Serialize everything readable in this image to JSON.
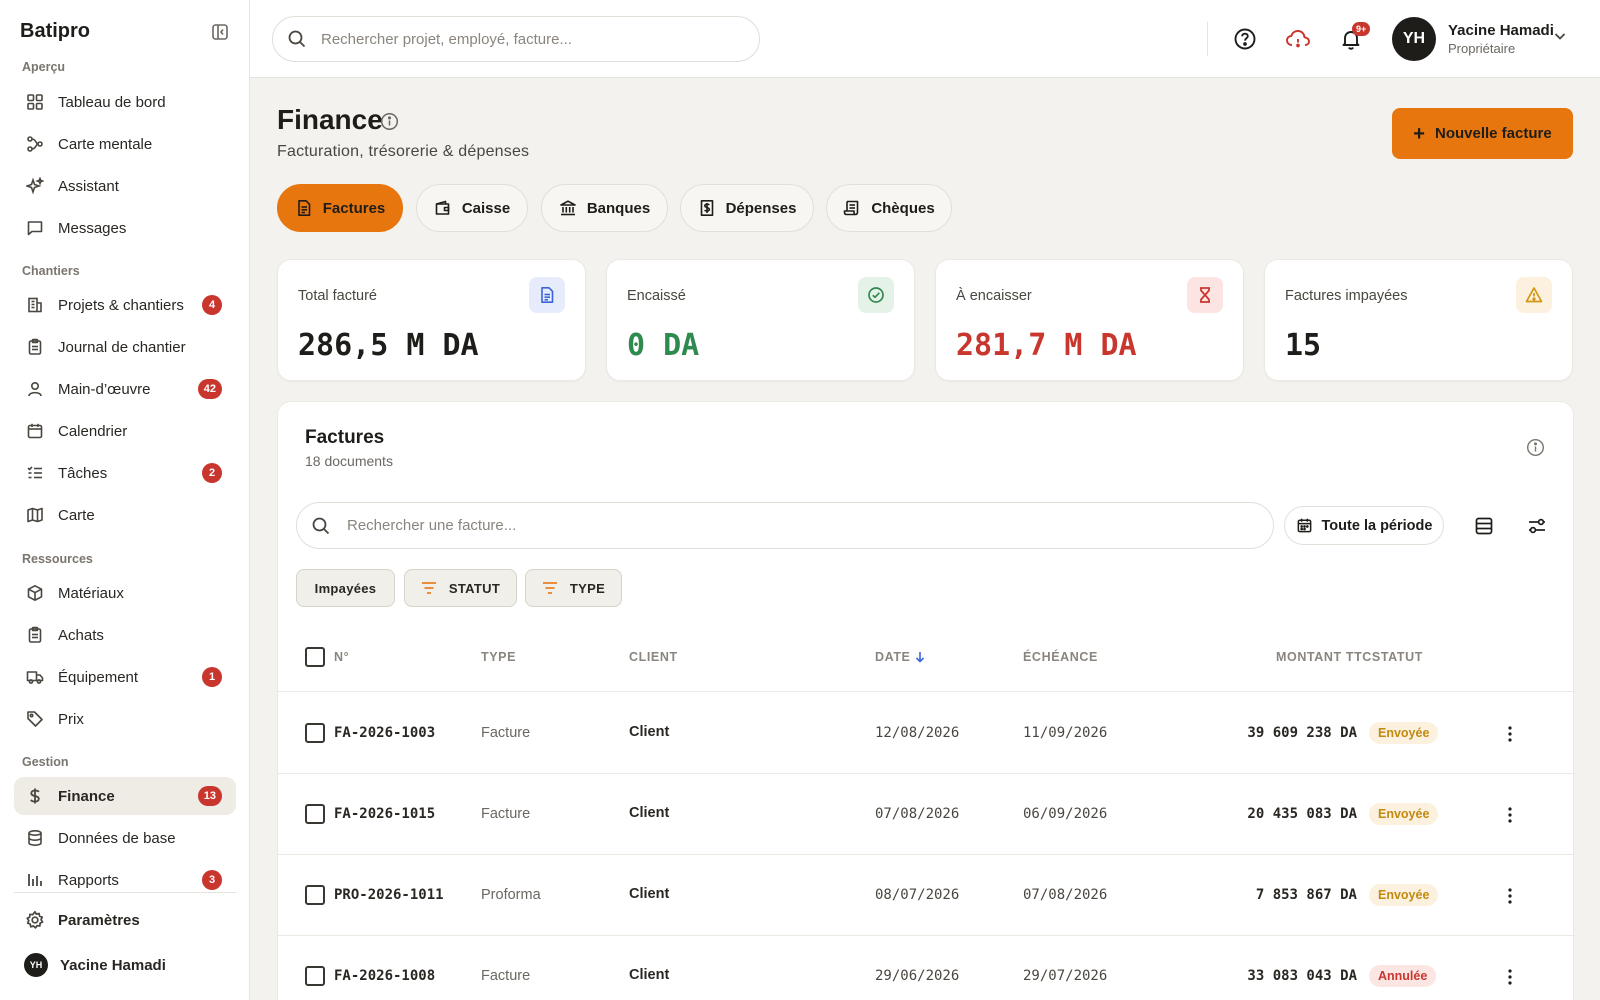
{
  "app": {
    "brand": "Batipro"
  },
  "sidebar": {
    "sections": {
      "apercu": "Aperçu",
      "chantiers": "Chantiers",
      "ressources": "Ressources",
      "gestion": "Gestion"
    },
    "items": [
      {
        "label": "Tableau de bord",
        "icon": "dashboard-icon"
      },
      {
        "label": "Carte mentale",
        "icon": "mindmap-icon"
      },
      {
        "label": "Assistant",
        "icon": "sparkle-icon"
      },
      {
        "label": "Messages",
        "icon": "message-icon"
      },
      {
        "label": "Projets & chantiers",
        "icon": "building-icon",
        "badge": "4"
      },
      {
        "label": "Journal de chantier",
        "icon": "clipboard-icon"
      },
      {
        "label": "Main-d’œuvre",
        "icon": "user-icon",
        "badge": "42"
      },
      {
        "label": "Calendrier",
        "icon": "calendar-icon"
      },
      {
        "label": "Tâches",
        "icon": "tasks-icon",
        "badge": "2"
      },
      {
        "label": "Carte",
        "icon": "map-icon"
      },
      {
        "label": "Matériaux",
        "icon": "box-icon"
      },
      {
        "label": "Achats",
        "icon": "clipboard-icon"
      },
      {
        "label": "Équipement",
        "icon": "truck-icon",
        "badge": "1"
      },
      {
        "label": "Prix",
        "icon": "tag-icon"
      },
      {
        "label": "Finance",
        "icon": "dollar-icon",
        "badge": "13"
      },
      {
        "label": "Données de base",
        "icon": "database-icon"
      },
      {
        "label": "Rapports",
        "icon": "bar-chart-icon",
        "badge": "3"
      }
    ],
    "settings": "Paramètres",
    "user": {
      "initials": "YH",
      "name": "Yacine Hamadi"
    }
  },
  "topbar": {
    "search_placeholder": "Rechercher projet, employé, facture...",
    "notif_badge": "9+",
    "user": {
      "initials": "YH",
      "name": "Yacine Hamadi",
      "role": "Propriétaire"
    }
  },
  "header": {
    "title": "Finance",
    "subtitle": "Facturation, trésorerie & dépenses",
    "new_invoice": "Nouvelle facture"
  },
  "tabs": [
    {
      "label": "Factures",
      "active": true
    },
    {
      "label": "Caisse"
    },
    {
      "label": "Banques"
    },
    {
      "label": "Dépenses"
    },
    {
      "label": "Chèques"
    }
  ],
  "stats": [
    {
      "label": "Total facturé",
      "value": "286,5 M DA",
      "color": "#1f1d1a",
      "icon": "document-icon"
    },
    {
      "label": "Encaissé",
      "value": "0 DA",
      "color": "#2f8a4f",
      "icon": "check-circle-icon"
    },
    {
      "label": "À encaisser",
      "value": "281,7 M DA",
      "color": "#c8362e",
      "icon": "hourglass-icon"
    },
    {
      "label": "Factures impayées",
      "value": "15",
      "color": "#1f1d1a",
      "icon": "warning-icon"
    }
  ],
  "invoices": {
    "title": "Factures",
    "count": "18 documents",
    "search_placeholder": "Rechercher une facture...",
    "period": "Toute la période",
    "chips": {
      "unpaid": "Impayées",
      "status": "STATUT",
      "type": "TYPE"
    },
    "columns": {
      "number": "N°",
      "type": "TYPE",
      "client": "CLIENT",
      "date": "DATE",
      "due": "ÉCHÉANCE",
      "amount_status": "MONTANT TTCSTATUT"
    },
    "rows": [
      {
        "number": "FA-2026-1003",
        "type": "Facture",
        "client": "Client",
        "date": "12/08/2026",
        "due": "11/09/2026",
        "amount": "39 609 238 DA",
        "status": "Envoyée"
      },
      {
        "number": "FA-2026-1015",
        "type": "Facture",
        "client": "Client",
        "date": "07/08/2026",
        "due": "06/09/2026",
        "amount": "20 435 083 DA",
        "status": "Envoyée"
      },
      {
        "number": "PRO-2026-1011",
        "type": "Proforma",
        "client": "Client",
        "date": "08/07/2026",
        "due": "07/08/2026",
        "amount": "7 853 867 DA",
        "status": "Envoyée"
      },
      {
        "number": "FA-2026-1008",
        "type": "Facture",
        "client": "Client",
        "date": "29/06/2026",
        "due": "29/07/2026",
        "amount": "33 083 043 DA",
        "status": "Annulée"
      }
    ]
  },
  "colors": {
    "accent": "#e8760f",
    "danger": "#c8362e",
    "success": "#2f8a4f",
    "warning": "#c28a10"
  }
}
